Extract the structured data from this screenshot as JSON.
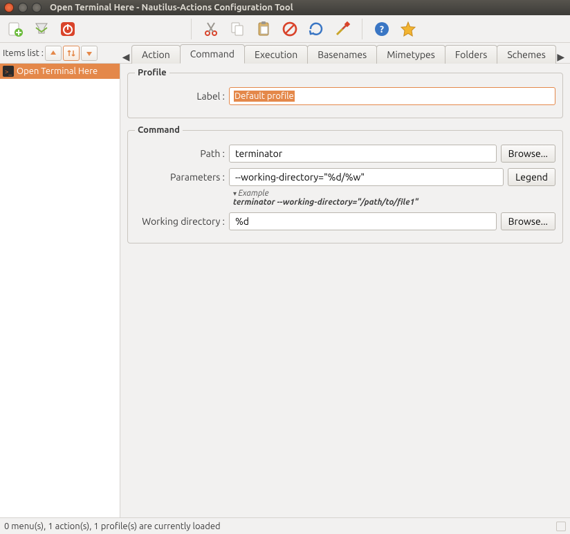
{
  "window": {
    "title": "Open Terminal Here - Nautilus-Actions Configuration Tool"
  },
  "itemslist_label": "Items list :",
  "tabs": {
    "action": "Action",
    "command": "Command",
    "execution": "Execution",
    "basenames": "Basenames",
    "mimetypes": "Mimetypes",
    "folders": "Folders",
    "schemes": "Schemes"
  },
  "sidebar": {
    "item0": "Open Terminal Here"
  },
  "profile": {
    "legend": "Profile",
    "label_label": "Label :",
    "label_value": "Default profile"
  },
  "command": {
    "legend": "Command",
    "path_label": "Path :",
    "path_value": "terminator",
    "browse": "Browse...",
    "params_label": "Parameters :",
    "params_value": "--working-directory=\"%d/%w\"",
    "legend_btn": "Legend",
    "example_hdr": "Example",
    "example_val": "terminator --working-directory=\"/path/to/file1\"",
    "wd_label": "Working directory :",
    "wd_value": "%d"
  },
  "status": "0 menu(s), 1 action(s), 1 profile(s) are currently loaded"
}
